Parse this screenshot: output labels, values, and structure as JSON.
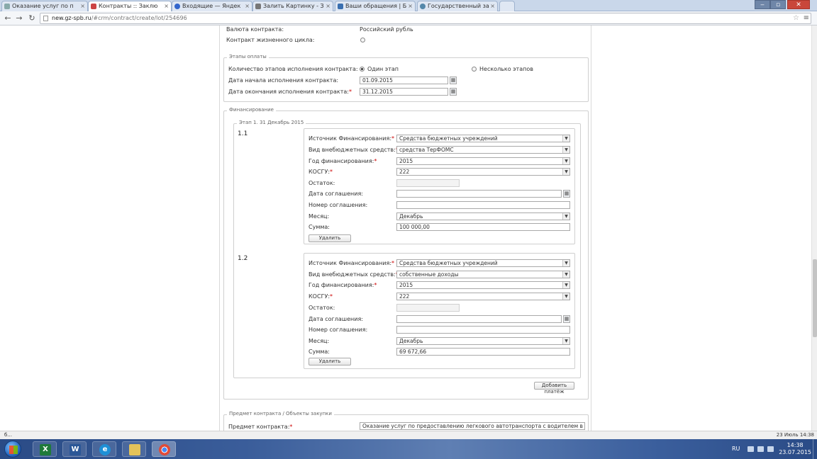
{
  "browser": {
    "tabs": [
      {
        "title": "Оказание услуг по п"
      },
      {
        "title": "Контракты :: Заклю"
      },
      {
        "title": "Входящие — Яндек"
      },
      {
        "title": "Залить Картинку - З"
      },
      {
        "title": "Ваши обращения | Б"
      },
      {
        "title": "Государственный за"
      }
    ],
    "url_host": "new.gz-spb.ru",
    "url_rest": "/#crm/contract/create/lot/254696"
  },
  "form": {
    "currency_label": "Валюта контракта:",
    "currency_value": "Российский рубль",
    "lifecycle_label": "Контракт жизненного цикла:",
    "payment": {
      "legend": "Этапы оплаты",
      "stages_label": "Количество этапов исполнения контракта:",
      "option_one": "Один этап",
      "option_many": "Несколько этапов",
      "start_label": "Дата начала исполнения контракта:",
      "start_value": "01.09.2015",
      "end_label": "Дата окончания исполнения контракта:",
      "end_value": "31.12.2015"
    },
    "financing": {
      "legend": "Финансирование",
      "stage_legend": "Этап 1. 31 Декабрь 2015",
      "labels": {
        "source": "Источник Финансирования:",
        "kind": "Вид внебюджетных средств:",
        "year": "Год финансирования:",
        "kosgu": "КОСГУ:",
        "remainder": "Остаток:",
        "agreement_date": "Дата соглашения:",
        "agreement_number": "Номер соглашения:",
        "month": "Месяц:",
        "sum": "Сумма:"
      },
      "delete_label": "Удалить",
      "add_payment_label": "Добавить платёж",
      "items": [
        {
          "number": "1.1",
          "source": "Средства бюджетных учреждений",
          "kind": "средства ТерФОМС",
          "year": "2015",
          "kosgu": "222",
          "remainder": "",
          "agreement_date": "",
          "agreement_number": "",
          "month": "Декабрь",
          "sum": "100 000,00"
        },
        {
          "number": "1.2",
          "source": "Средства бюджетных учреждений",
          "kind": "собственные доходы",
          "year": "2015",
          "kosgu": "222",
          "remainder": "",
          "agreement_date": "",
          "agreement_number": "",
          "month": "Декабрь",
          "sum": "69 672,66"
        }
      ]
    },
    "subject": {
      "legend": "Предмет контракта / Объекты закупки",
      "label": "Предмет контракта:",
      "value": "Оказание услуг по предоставлению легкового автотранспорта с водителем в сентябре"
    }
  },
  "statusbar": {
    "left": "б...",
    "right": "23 Июль 14:38"
  },
  "taskbar": {
    "lang": "RU",
    "time": "14:38",
    "date": "23.07.2015"
  }
}
